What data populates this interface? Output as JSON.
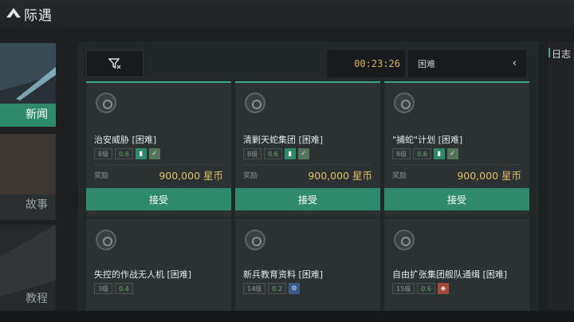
{
  "header": {
    "title": "际遇",
    "logo_icon": "winged-emblem-icon"
  },
  "sidebar": {
    "items": [
      {
        "label": "新闻",
        "active": true
      },
      {
        "label": "故事",
        "active": false
      },
      {
        "label": "教程",
        "active": false
      }
    ]
  },
  "toolbar": {
    "filter_icon": "filter-icon",
    "timer": "00:23:26",
    "difficulty": "困难",
    "chevron": "‹"
  },
  "right_panel": {
    "label": "日志"
  },
  "missions": [
    {
      "title": "治安威胁 [困难]",
      "tags": [
        "8级",
        "0.6"
      ],
      "reward_label": "奖励",
      "reward": "900,000 星币",
      "accept": "接受"
    },
    {
      "title": "清剿天蛇集团 [困难]",
      "tags": [
        "8级",
        "0.6"
      ],
      "reward_label": "奖励",
      "reward": "900,000 星币",
      "accept": "接受"
    },
    {
      "title": "\"捕蛇\"计划 [困难]",
      "tags": [
        "8级",
        "0.6"
      ],
      "reward_label": "奖励",
      "reward": "900,000 星币",
      "accept": "接受"
    },
    {
      "title": "失控的作战无人机 [困难]",
      "tags": [
        "3级",
        "0.4"
      ]
    },
    {
      "title": "新兵教育资料 [困难]",
      "tags": [
        "14级",
        "0.2"
      ]
    },
    {
      "title": "自由扩张集团舰队通缉 [困难]",
      "tags": [
        "15级",
        "0.6"
      ]
    }
  ],
  "colors": {
    "accent": "#2f8a6c",
    "reward": "#e0bf6a",
    "timer": "#d8b25a"
  }
}
